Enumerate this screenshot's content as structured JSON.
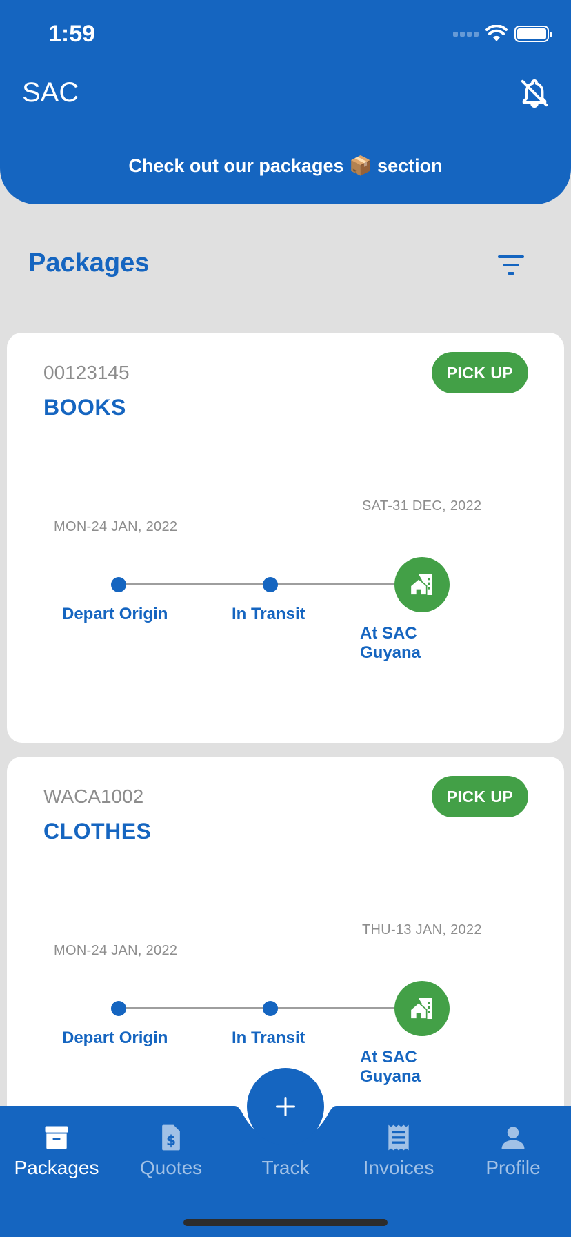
{
  "status_bar": {
    "time": "1:59"
  },
  "header": {
    "title": "SAC",
    "banner": "Check out our packages 📦 section",
    "notification_icon": "bell-off-icon"
  },
  "section": {
    "title": "Packages",
    "filter_icon": "filter-icon"
  },
  "packages": [
    {
      "id": "00123145",
      "name": "BOOKS",
      "action": "PICK UP",
      "end_date": "SAT-31 DEC, 2022",
      "start_date": "MON-24 JAN, 2022",
      "steps": [
        "Depart Origin",
        "In Transit",
        "At SAC Guyana"
      ]
    },
    {
      "id": "WACA1002",
      "name": "CLOTHES",
      "action": "PICK UP",
      "end_date": "THU-13 JAN, 2022",
      "start_date": "MON-24 JAN, 2022",
      "steps": [
        "Depart Origin",
        "In Transit",
        "At SAC Guyana"
      ]
    }
  ],
  "tabs": [
    {
      "label": "Packages",
      "icon": "archive-icon"
    },
    {
      "label": "Quotes",
      "icon": "dollar-doc-icon"
    },
    {
      "label": "Track",
      "icon": "plus-icon"
    },
    {
      "label": "Invoices",
      "icon": "receipt-icon"
    },
    {
      "label": "Profile",
      "icon": "person-icon"
    }
  ],
  "colors": {
    "primary": "#1565c0",
    "success": "#43a047",
    "background": "#e0e0e0"
  }
}
